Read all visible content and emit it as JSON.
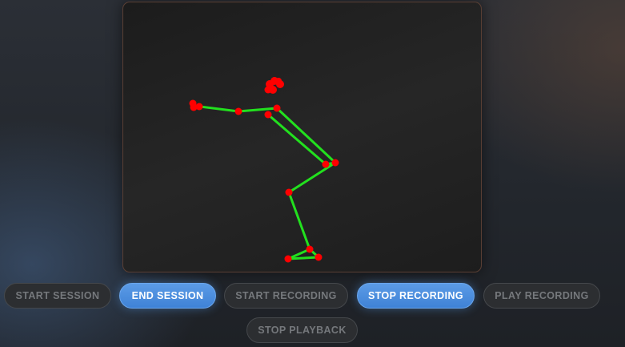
{
  "buttons": [
    {
      "label": "START SESSION",
      "state": "disabled"
    },
    {
      "label": "END SESSION",
      "state": "active"
    },
    {
      "label": "START RECORDING",
      "state": "disabled"
    },
    {
      "label": "STOP RECORDING",
      "state": "active"
    },
    {
      "label": "PLAY RECORDING",
      "state": "disabled"
    },
    {
      "label": "STOP PLAYBACK",
      "state": "disabled"
    }
  ],
  "colors": {
    "skeleton_line": "#22e01e",
    "joint": "#ff0000",
    "button_active": "#4a8ddf",
    "button_disabled": "#2c2e31"
  }
}
